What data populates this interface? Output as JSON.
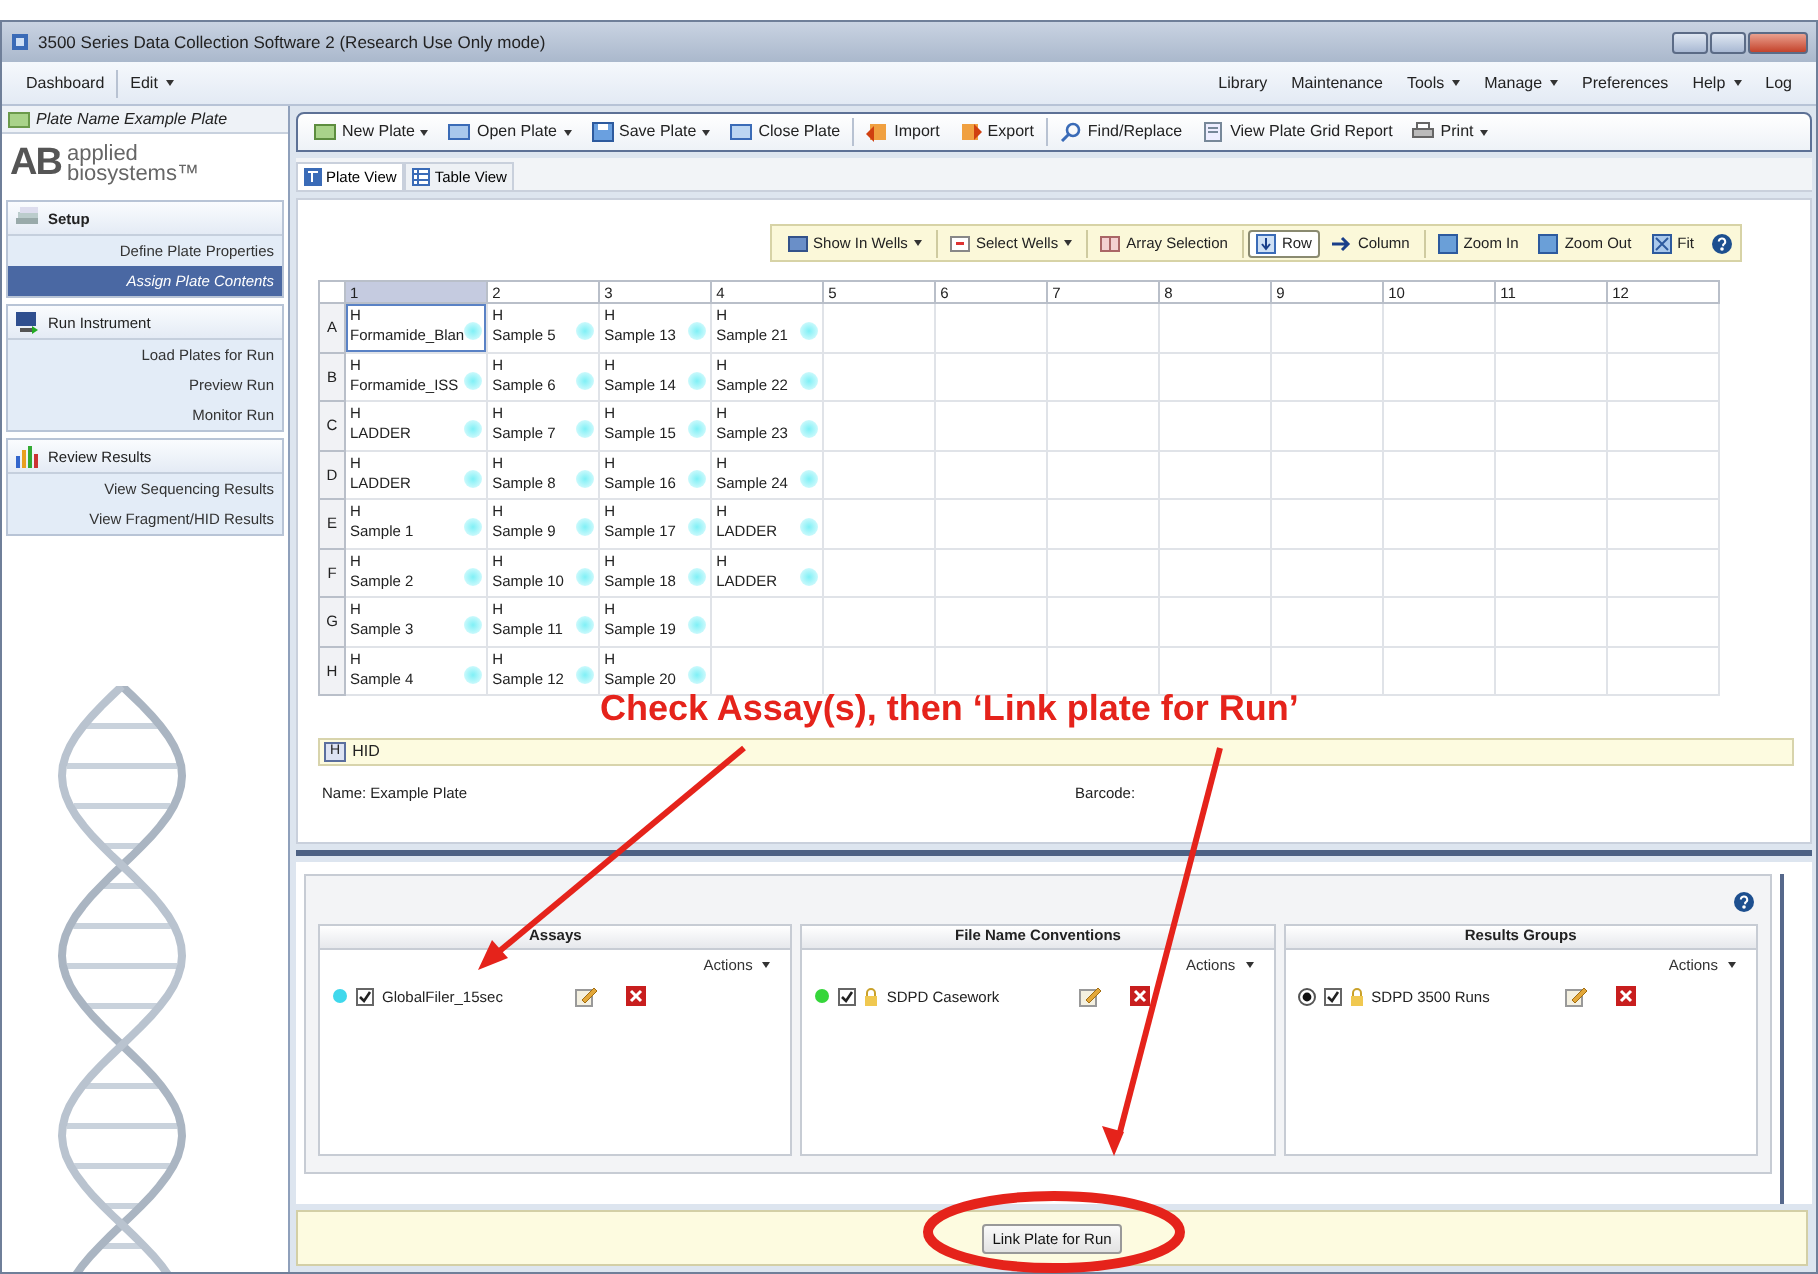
{
  "window": {
    "title": "3500 Series Data Collection Software 2 (Research Use Only mode)"
  },
  "menu_bar": {
    "left": [
      {
        "label": "Dashboard",
        "dropdown": false
      },
      {
        "label": "Edit",
        "dropdown": true
      }
    ],
    "right": [
      {
        "label": "Library",
        "dropdown": false
      },
      {
        "label": "Maintenance",
        "dropdown": false
      },
      {
        "label": "Tools",
        "dropdown": true
      },
      {
        "label": "Manage",
        "dropdown": true
      },
      {
        "label": "Preferences",
        "dropdown": false
      },
      {
        "label": "Help",
        "dropdown": true
      },
      {
        "label": "Log",
        "dropdown": false
      }
    ]
  },
  "sidebar": {
    "plate_name": "Plate Name Example Plate",
    "logo": {
      "mark": "AB",
      "lines": [
        "applied",
        "biosystems™"
      ]
    },
    "sections": [
      {
        "title": "Setup",
        "items": [
          {
            "label": "Define Plate Properties",
            "selected": false
          },
          {
            "label": "Assign Plate Contents",
            "selected": true
          }
        ]
      },
      {
        "title": "Run Instrument",
        "items": [
          {
            "label": "Load Plates for Run",
            "selected": false
          },
          {
            "label": "Preview Run",
            "selected": false
          },
          {
            "label": "Monitor Run",
            "selected": false
          }
        ]
      },
      {
        "title": "Review Results",
        "items": [
          {
            "label": "View Sequencing Results",
            "selected": false
          },
          {
            "label": "View Fragment/HID Results",
            "selected": false
          }
        ]
      }
    ]
  },
  "toolbar": [
    [
      {
        "label": "New Plate",
        "dropdown": true
      },
      {
        "label": "Open Plate",
        "dropdown": true
      },
      {
        "label": "Save Plate",
        "dropdown": true
      },
      {
        "label": "Close Plate",
        "dropdown": false
      }
    ],
    [
      {
        "label": "Import",
        "dropdown": false
      },
      {
        "label": "Export",
        "dropdown": false
      }
    ],
    [
      {
        "label": "Find/Replace",
        "dropdown": false
      },
      {
        "label": "View Plate Grid Report",
        "dropdown": false
      },
      {
        "label": "Print",
        "dropdown": true
      }
    ]
  ],
  "view_tabs": [
    {
      "label": "Plate View",
      "selected": true
    },
    {
      "label": "Table View",
      "selected": false
    }
  ],
  "plate_toolbar": [
    [
      {
        "label": "Show In Wells",
        "dropdown": true
      }
    ],
    [
      {
        "label": "Select Wells",
        "dropdown": true
      }
    ],
    [
      {
        "label": "Array Selection",
        "dropdown": false
      }
    ],
    [
      {
        "label": "Row",
        "dropdown": false,
        "selected": true
      },
      {
        "label": "Column",
        "dropdown": false,
        "selected": false
      }
    ],
    [
      {
        "label": "Zoom In",
        "dropdown": false
      },
      {
        "label": "Zoom Out",
        "dropdown": false
      },
      {
        "label": "Fit",
        "dropdown": false
      }
    ]
  ],
  "plate": {
    "columns": [
      "1",
      "2",
      "3",
      "4",
      "5",
      "6",
      "7",
      "8",
      "9",
      "10",
      "11",
      "12"
    ],
    "rows": [
      {
        "label": "A",
        "wells": [
          {
            "tag": "H",
            "name": "Formamide_Blan",
            "selected": true
          },
          {
            "tag": "H",
            "name": "Sample 5",
            "selected": false
          },
          {
            "tag": "H",
            "name": "Sample 13",
            "selected": false
          },
          {
            "tag": "H",
            "name": "Sample 21",
            "selected": false
          }
        ]
      },
      {
        "label": "B",
        "wells": [
          {
            "tag": "H",
            "name": "Formamide_ISS",
            "selected": false
          },
          {
            "tag": "H",
            "name": "Sample 6",
            "selected": false
          },
          {
            "tag": "H",
            "name": "Sample 14",
            "selected": false
          },
          {
            "tag": "H",
            "name": "Sample 22",
            "selected": false
          }
        ]
      },
      {
        "label": "C",
        "wells": [
          {
            "tag": "H",
            "name": "LADDER",
            "selected": false
          },
          {
            "tag": "H",
            "name": "Sample 7",
            "selected": false
          },
          {
            "tag": "H",
            "name": "Sample 15",
            "selected": false
          },
          {
            "tag": "H",
            "name": "Sample 23",
            "selected": false
          }
        ]
      },
      {
        "label": "D",
        "wells": [
          {
            "tag": "H",
            "name": "LADDER",
            "selected": false
          },
          {
            "tag": "H",
            "name": "Sample 8",
            "selected": false
          },
          {
            "tag": "H",
            "name": "Sample 16",
            "selected": false
          },
          {
            "tag": "H",
            "name": "Sample 24",
            "selected": false
          }
        ]
      },
      {
        "label": "E",
        "wells": [
          {
            "tag": "H",
            "name": "Sample 1",
            "selected": false
          },
          {
            "tag": "H",
            "name": "Sample 9",
            "selected": false
          },
          {
            "tag": "H",
            "name": "Sample 17",
            "selected": false
          },
          {
            "tag": "H",
            "name": "LADDER",
            "selected": false
          }
        ]
      },
      {
        "label": "F",
        "wells": [
          {
            "tag": "H",
            "name": "Sample 2",
            "selected": false
          },
          {
            "tag": "H",
            "name": "Sample 10",
            "selected": false
          },
          {
            "tag": "H",
            "name": "Sample 18",
            "selected": false
          },
          {
            "tag": "H",
            "name": "LADDER",
            "selected": false
          }
        ]
      },
      {
        "label": "G",
        "wells": [
          {
            "tag": "H",
            "name": "Sample 3",
            "selected": false
          },
          {
            "tag": "H",
            "name": "Sample 11",
            "selected": false
          },
          {
            "tag": "H",
            "name": "Sample 19",
            "selected": false
          }
        ]
      },
      {
        "label": "H",
        "wells": [
          {
            "tag": "H",
            "name": "Sample 4",
            "selected": false
          },
          {
            "tag": "H",
            "name": "Sample 12",
            "selected": false
          },
          {
            "tag": "H",
            "name": "Sample 20",
            "selected": false
          }
        ]
      }
    ]
  },
  "annotation": {
    "text": "Check Assay(s), then ‘Link plate for Run’"
  },
  "legend": [
    {
      "tag": "H",
      "label": "HID"
    }
  ],
  "plate_info": {
    "name": "Name: Example Plate",
    "barcode": "Barcode:"
  },
  "panels": [
    {
      "title": "Assays",
      "actions": "Actions",
      "items": [
        {
          "kind": "dot",
          "color": "#3fd8ec",
          "checked": true,
          "locked": false,
          "name": "GlobalFiler_15sec"
        }
      ]
    },
    {
      "title": "File Name Conventions",
      "actions": "Actions",
      "items": [
        {
          "kind": "dot",
          "color": "#35d63a",
          "checked": true,
          "locked": true,
          "name": "SDPD Casework"
        }
      ]
    },
    {
      "title": "Results Groups",
      "actions": "Actions",
      "items": [
        {
          "kind": "radio",
          "selected": true,
          "checked": true,
          "locked": true,
          "name": "SDPD 3500 Runs"
        }
      ]
    }
  ],
  "footer": {
    "button": "Link Plate for Run"
  }
}
